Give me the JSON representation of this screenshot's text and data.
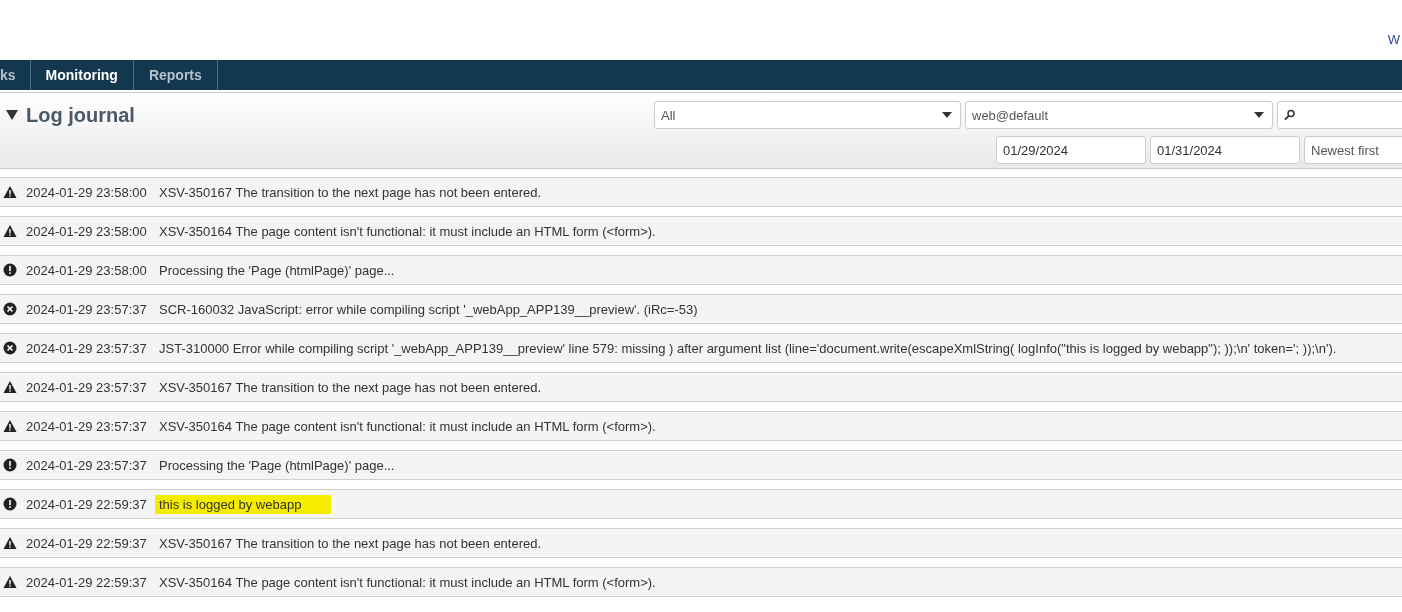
{
  "top_link": "W",
  "tabs": [
    {
      "label": "ks",
      "selected": false
    },
    {
      "label": "Monitoring",
      "selected": true
    },
    {
      "label": "Reports",
      "selected": false
    }
  ],
  "panel": {
    "title": "Log journal",
    "expanded": true,
    "filters": {
      "level": "All",
      "account": "web@default",
      "from_date": "01/29/2024",
      "to_date": "01/31/2024",
      "sort": "Newest first"
    }
  },
  "entries": [
    {
      "kind": "warning",
      "time": "2024-01-29 23:58:00",
      "message": "XSV-350167 The transition to the next page has not been entered.",
      "highlighted": false
    },
    {
      "kind": "warning",
      "time": "2024-01-29 23:58:00",
      "message": "XSV-350164 The page content isn't functional: it must include an HTML form (<form>).",
      "highlighted": false
    },
    {
      "kind": "info",
      "time": "2024-01-29 23:58:00",
      "message": "Processing the 'Page (htmlPage)' page...",
      "highlighted": false
    },
    {
      "kind": "error",
      "time": "2024-01-29 23:57:37",
      "message": "SCR-160032 JavaScript: error while compiling script '_webApp_APP139__preview'. (iRc=-53)",
      "highlighted": false
    },
    {
      "kind": "error",
      "time": "2024-01-29 23:57:37",
      "message": "JST-310000 Error while compiling script '_webApp_APP139__preview' line 579: missing ) after argument list (line='document.write(escapeXmlString( logInfo(\"this is logged by webapp\"); ));\\n' token='; ));\\n').",
      "highlighted": false
    },
    {
      "kind": "warning",
      "time": "2024-01-29 23:57:37",
      "message": "XSV-350167 The transition to the next page has not been entered.",
      "highlighted": false
    },
    {
      "kind": "warning",
      "time": "2024-01-29 23:57:37",
      "message": "XSV-350164 The page content isn't functional: it must include an HTML form (<form>).",
      "highlighted": false
    },
    {
      "kind": "info",
      "time": "2024-01-29 23:57:37",
      "message": "Processing the 'Page (htmlPage)' page...",
      "highlighted": false
    },
    {
      "kind": "info",
      "time": "2024-01-29 22:59:37",
      "message": "this is logged by webapp",
      "highlighted": true
    },
    {
      "kind": "warning",
      "time": "2024-01-29 22:59:37",
      "message": "XSV-350167 The transition to the next page has not been entered.",
      "highlighted": false
    },
    {
      "kind": "warning",
      "time": "2024-01-29 22:59:37",
      "message": "XSV-350164 The page content isn't functional: it must include an HTML form (<form>).",
      "highlighted": false
    }
  ]
}
